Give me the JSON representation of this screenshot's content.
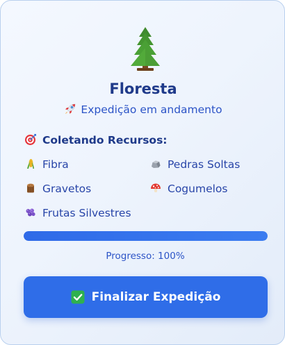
{
  "expedition": {
    "title": "Floresta",
    "status_icon": "rocket-icon",
    "status": "Expedição em andamento",
    "location_icon": "pine-tree-icon"
  },
  "resources": {
    "section_icon": "target-icon",
    "section_title": "Coletando Recursos:",
    "items": [
      {
        "icon": "corn-icon",
        "label": "Fibra"
      },
      {
        "icon": "rock-icon",
        "label": "Pedras Soltas"
      },
      {
        "icon": "wood-icon",
        "label": "Gravetos"
      },
      {
        "icon": "mushroom-icon",
        "label": "Cogumelos"
      },
      {
        "icon": "grapes-icon",
        "label": "Frutas Silvestres"
      }
    ]
  },
  "progress": {
    "label": "Progresso: 100%",
    "value": 100
  },
  "action": {
    "icon": "check-icon",
    "label": "Finalizar Expedição"
  },
  "colors": {
    "title": "#1f3a8a",
    "accent": "#2f6de8",
    "progress_fill": "#2f6ae8",
    "progress_track": "#d3e0f5",
    "text": "#2845a8"
  }
}
